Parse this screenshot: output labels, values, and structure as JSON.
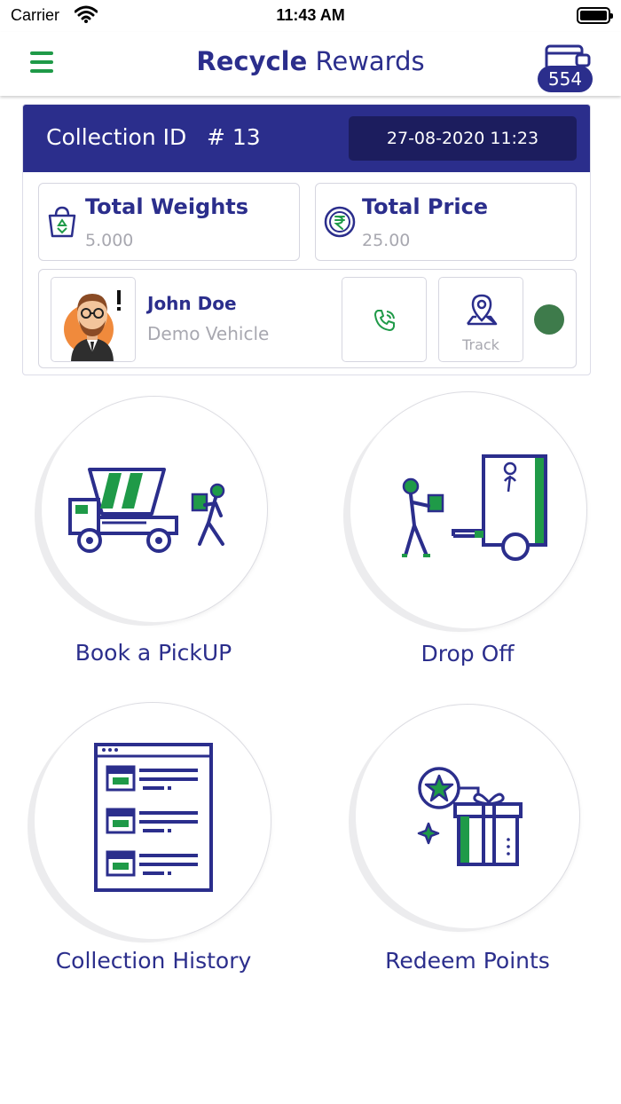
{
  "status_bar": {
    "carrier": "Carrier",
    "time": "11:43 AM"
  },
  "header": {
    "title_bold": "Recycle",
    "title_rest": " Rewards",
    "points": "554"
  },
  "collection": {
    "label": "Collection ID",
    "id": "# 13",
    "datetime": "27-08-2020 11:23",
    "weights_label": "Total Weights",
    "weights_value": "5.000",
    "price_label": "Total Price",
    "price_value": "25.00"
  },
  "driver": {
    "name": "John Doe",
    "vehicle": "Demo Vehicle",
    "track_label": "Track",
    "status_color": "#3e7b4b"
  },
  "tiles": [
    {
      "label": "Book a PickUP",
      "icon": "dump-truck-icon"
    },
    {
      "label": "Drop Off",
      "icon": "recycle-van-icon"
    },
    {
      "label": "Collection History",
      "icon": "history-list-icon"
    },
    {
      "label": "Redeem Points",
      "icon": "gift-points-icon"
    }
  ],
  "colors": {
    "brand_navy": "#2b2e8c",
    "brand_green": "#1f9a48",
    "dark_navy": "#1c1d5e"
  }
}
